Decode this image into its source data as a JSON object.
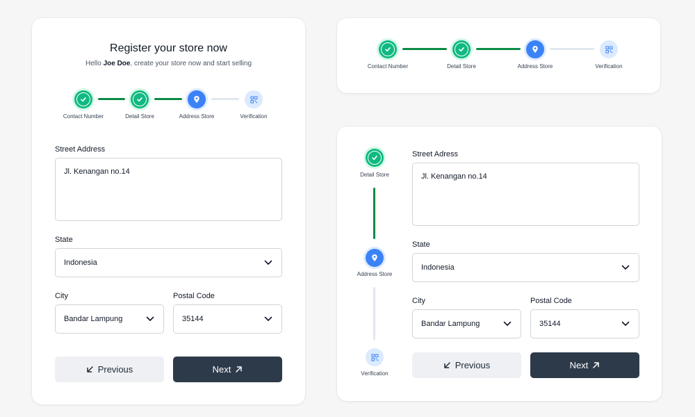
{
  "left_card": {
    "title": "Register your store now",
    "subtitle_prefix": "Hello ",
    "user_name": "Joe Doe",
    "subtitle_suffix": ", create your store now and start selling",
    "steps": [
      {
        "label": "Contact Number",
        "status": "done",
        "icon": "check-icon"
      },
      {
        "label": "Detail Store",
        "status": "done",
        "icon": "check-icon"
      },
      {
        "label": "Address Store",
        "status": "active",
        "icon": "location-pin-icon"
      },
      {
        "label": "Verification",
        "status": "pending",
        "icon": "qr-code-icon"
      }
    ],
    "street_label": "Street Address",
    "street_value": "Jl. Kenangan no.14",
    "state_label": "State",
    "state_value": "Indonesia",
    "city_label": "City",
    "city_value": "Bandar Lampung",
    "postal_label": "Postal Code",
    "postal_value": "35144",
    "prev_label": "Previous",
    "next_label": "Next"
  },
  "top_card": {
    "steps": [
      {
        "label": "Contact Number",
        "status": "done",
        "icon": "check-icon"
      },
      {
        "label": "Detail Store",
        "status": "done",
        "icon": "check-icon"
      },
      {
        "label": "Address Store",
        "status": "active",
        "icon": "location-pin-icon"
      },
      {
        "label": "Verification",
        "status": "pending",
        "icon": "qr-code-icon"
      }
    ]
  },
  "right_card": {
    "steps": [
      {
        "label": "Detail Store",
        "status": "done",
        "icon": "check-icon"
      },
      {
        "label": "Address Store",
        "status": "active",
        "icon": "location-pin-icon"
      },
      {
        "label": "Verification",
        "status": "pending",
        "icon": "qr-code-icon"
      }
    ],
    "street_label": "Street Adress",
    "street_value": "Jl. Kenangan no.14",
    "state_label": "State",
    "state_value": "Indonesia",
    "city_label": "City",
    "city_value": "Bandar Lampung",
    "postal_label": "Postal Code",
    "postal_value": "35144",
    "prev_label": "Previous",
    "next_label": "Next"
  },
  "colors": {
    "done": "#10b981",
    "connector_done": "#0b8a45",
    "active": "#3b82f6",
    "pending": "#dbeafe",
    "primary_button": "#2d3a4a",
    "secondary_button": "#eef0f3"
  }
}
